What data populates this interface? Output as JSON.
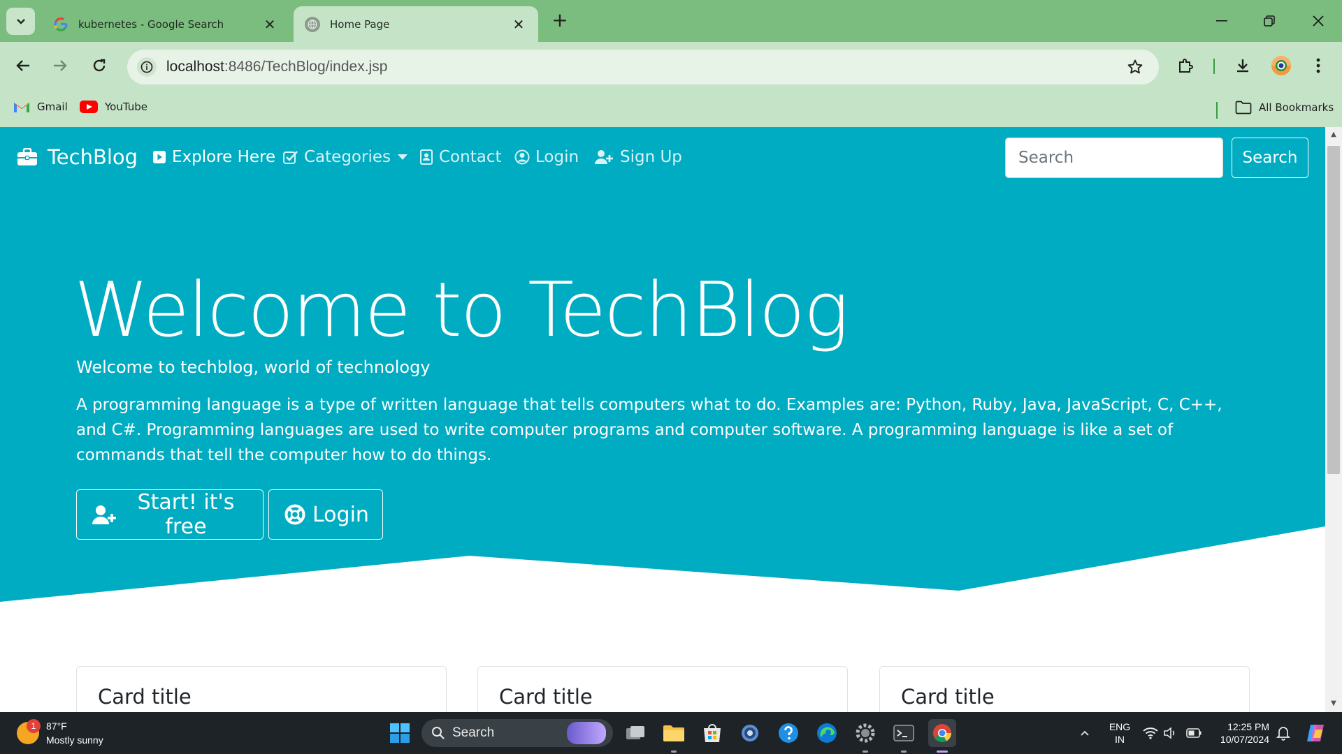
{
  "browser": {
    "tabs": [
      {
        "title": "kubernetes - Google Search",
        "active": false
      },
      {
        "title": "Home Page",
        "active": true
      }
    ],
    "url_host": "localhost",
    "url_path": ":8486/TechBlog/index.jsp",
    "bookmarks": [
      {
        "label": "Gmail"
      },
      {
        "label": "YouTube"
      }
    ],
    "all_bookmarks_label": "All Bookmarks"
  },
  "navbar": {
    "brand": "TechBlog",
    "links": [
      {
        "label": "Explore Here"
      },
      {
        "label": "Categories"
      },
      {
        "label": "Contact"
      },
      {
        "label": "Login"
      },
      {
        "label": "Sign Up"
      }
    ],
    "search_placeholder": "Search",
    "search_button": "Search"
  },
  "hero": {
    "title": "Welcome to TechBlog",
    "lead": "Welcome to techblog, world of technology",
    "text": "A programming language is a type of written language that tells computers what to do. Examples are: Python, Ruby, Java, JavaScript, C, C++, and C#. Programming languages are used to write computer programs and computer software. A programming language is like a set of commands that tell the computer how to do things.",
    "buttons": [
      {
        "label": "Start! it's free"
      },
      {
        "label": "Login"
      }
    ]
  },
  "cards": [
    {
      "title": "Card title"
    },
    {
      "title": "Card title"
    },
    {
      "title": "Card title"
    }
  ],
  "colors": {
    "hero": "#00acc1",
    "tabstrip": "#7bbd7e",
    "toolbar": "#c5e3c6",
    "taskbar": "#1d2327"
  },
  "taskbar": {
    "weather_badge": "1",
    "weather_temp": "87°F",
    "weather_desc": "Mostly sunny",
    "search_label": "Search",
    "language": "ENG",
    "region": "IN",
    "time": "12:25 PM",
    "date": "10/07/2024"
  }
}
